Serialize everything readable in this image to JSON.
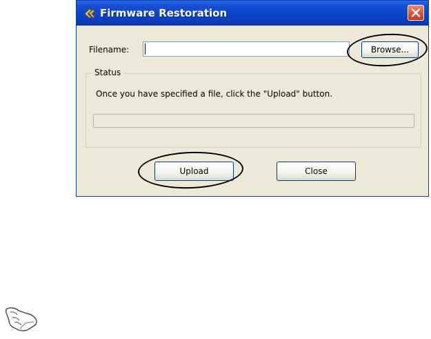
{
  "window": {
    "title": "Firmware Restoration",
    "icons": {
      "app": "firmware-restoration-icon",
      "close": "close-icon"
    }
  },
  "filename": {
    "label": "Filename:",
    "value": "",
    "placeholder": "",
    "browse_label": "Browse..."
  },
  "status": {
    "group_label": "Status",
    "message": "Once you have specified a file, click the \"Upload\" button.",
    "progress": 0
  },
  "buttons": {
    "upload_label": "Upload",
    "close_label": "Close"
  },
  "annotations": {
    "highlight_color": "#000000",
    "note_icon": "pointing-hand-note-icon"
  },
  "colors": {
    "titlebar": "#0d44c8",
    "window_bg": "#ece9d8",
    "close_button": "#e35b34"
  }
}
